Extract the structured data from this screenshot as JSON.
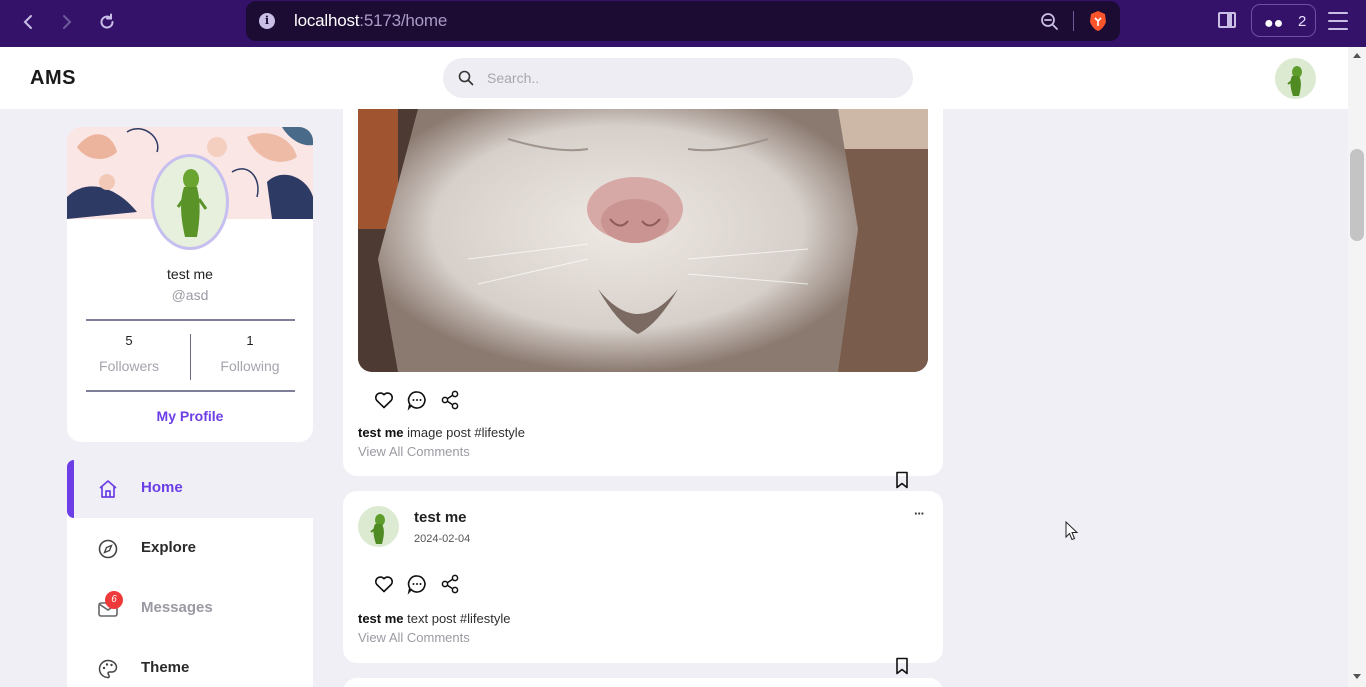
{
  "browser": {
    "url_host": "localhost",
    "url_path": ":5173/home",
    "tab_count": "2",
    "accent": "#34126a"
  },
  "app": {
    "brand": "AMS",
    "search_placeholder": "Search..",
    "primary_color": "#6c3ee6"
  },
  "profile": {
    "name": "test me",
    "handle": "@asd",
    "stats": [
      {
        "value": "5",
        "label": "Followers"
      },
      {
        "value": "1",
        "label": "Following"
      }
    ],
    "link_label": "My Profile"
  },
  "nav": {
    "items": [
      {
        "label": "Home",
        "icon": "home-icon",
        "active": true
      },
      {
        "label": "Explore",
        "icon": "compass-icon",
        "active": false
      },
      {
        "label": "Messages",
        "icon": "mail-icon",
        "active": false,
        "badge": "6"
      },
      {
        "label": "Theme",
        "icon": "palette-icon",
        "active": false
      }
    ]
  },
  "feed": {
    "posts": [
      {
        "caption_user": "test me",
        "caption_text": " image post #lifestyle",
        "comments_link": "View All Comments"
      },
      {
        "author": "test me",
        "date": "2024-02-04",
        "more": "···",
        "caption_user": "test me",
        "caption_text": " text post #lifestyle",
        "comments_link": "View All Comments"
      }
    ]
  }
}
